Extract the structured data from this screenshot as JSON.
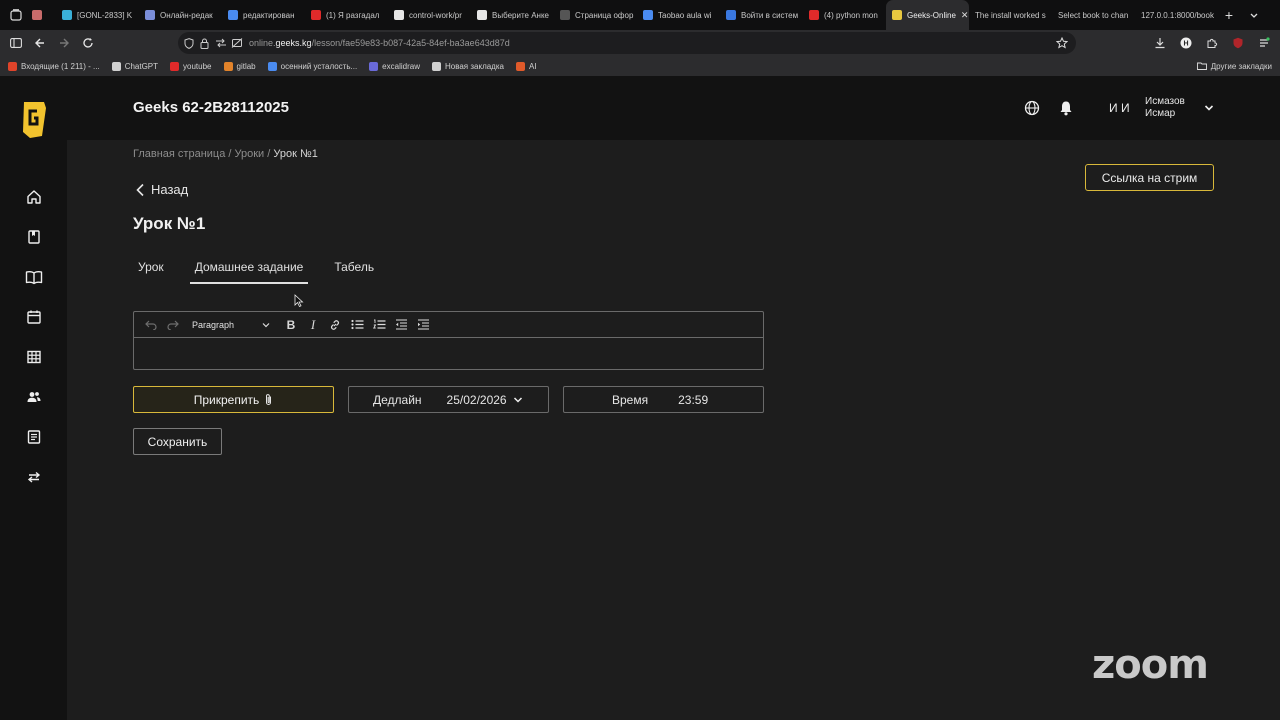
{
  "browser": {
    "tabs": [
      {
        "label": "",
        "color": "#c86b6b"
      },
      {
        "label": "[GONL-2833] K",
        "color": "#3ab0d8"
      },
      {
        "label": "Онлайн-редак",
        "color": "#7a8dd8"
      },
      {
        "label": "редактирован",
        "color": "#4a8bf0"
      },
      {
        "label": "(1) Я разгадал",
        "color": "#e02a2a"
      },
      {
        "label": "control-work/pr",
        "color": "#e6e6e6"
      },
      {
        "label": "Выберите Анке",
        "color": "#e6e6e6"
      },
      {
        "label": "Страница офор",
        "color": "#555555"
      },
      {
        "label": "Taobao aula wi",
        "color": "#4a8bf0"
      },
      {
        "label": "Войти в систем",
        "color": "#3a78e0"
      },
      {
        "label": "(4) python mon",
        "color": "#e02a2a"
      },
      {
        "label": "Geeks-Online",
        "color": "#e8c840",
        "active": true
      },
      {
        "label": "The install worked s",
        "color": ""
      },
      {
        "label": "Select book to chan",
        "color": ""
      },
      {
        "label": "127.0.0.1:8000/book",
        "color": ""
      }
    ],
    "url_prefix": "online.",
    "url_host": "geeks.kg",
    "url_path": "/lesson/fae59e83-b087-42a5-84ef-ba3ae643d87d",
    "bookmarks": [
      {
        "label": "Входящие (1 211) - ...",
        "color": "#e0442a"
      },
      {
        "label": "ChatGPT",
        "color": "#d0d0d0"
      },
      {
        "label": "youtube",
        "color": "#e02a2a"
      },
      {
        "label": "gitlab",
        "color": "#e2832a"
      },
      {
        "label": "осенний усталость...",
        "color": "#4a8bf0"
      },
      {
        "label": "excalidraw",
        "color": "#6a6ad8"
      },
      {
        "label": "Новая закладка",
        "color": "#d0d0d0"
      },
      {
        "label": "AI",
        "color": "#e05a2a"
      }
    ],
    "other_bookmarks": "Другие закладки"
  },
  "header": {
    "group_title": "Geeks 62-2B28112025",
    "initials": "И И",
    "user_last": "Исмазов",
    "user_first": "Исмар"
  },
  "breadcrumb": {
    "home": "Главная страница",
    "lessons": "Уроки",
    "current": "Урок №1",
    "separator": " / "
  },
  "back_label": "Назад",
  "page_title": "Урок №1",
  "stream_label": "Ссылка на стрим",
  "tabs": [
    {
      "label": "Урок",
      "active": false
    },
    {
      "label": "Домашнее задание",
      "active": true
    },
    {
      "label": "Табель",
      "active": false
    }
  ],
  "editor": {
    "block_type": "Paragraph",
    "content": ""
  },
  "attach_label": "Прикрепить",
  "deadline_label": "Дедлайн",
  "deadline_value": "25/02/2026",
  "time_label": "Время",
  "time_value": "23:59",
  "save_label": "Сохранить",
  "zoom_watermark": "zoom",
  "colors": {
    "accent": "#d8b83a",
    "background": "#1d1d1d",
    "header": "#121212"
  }
}
